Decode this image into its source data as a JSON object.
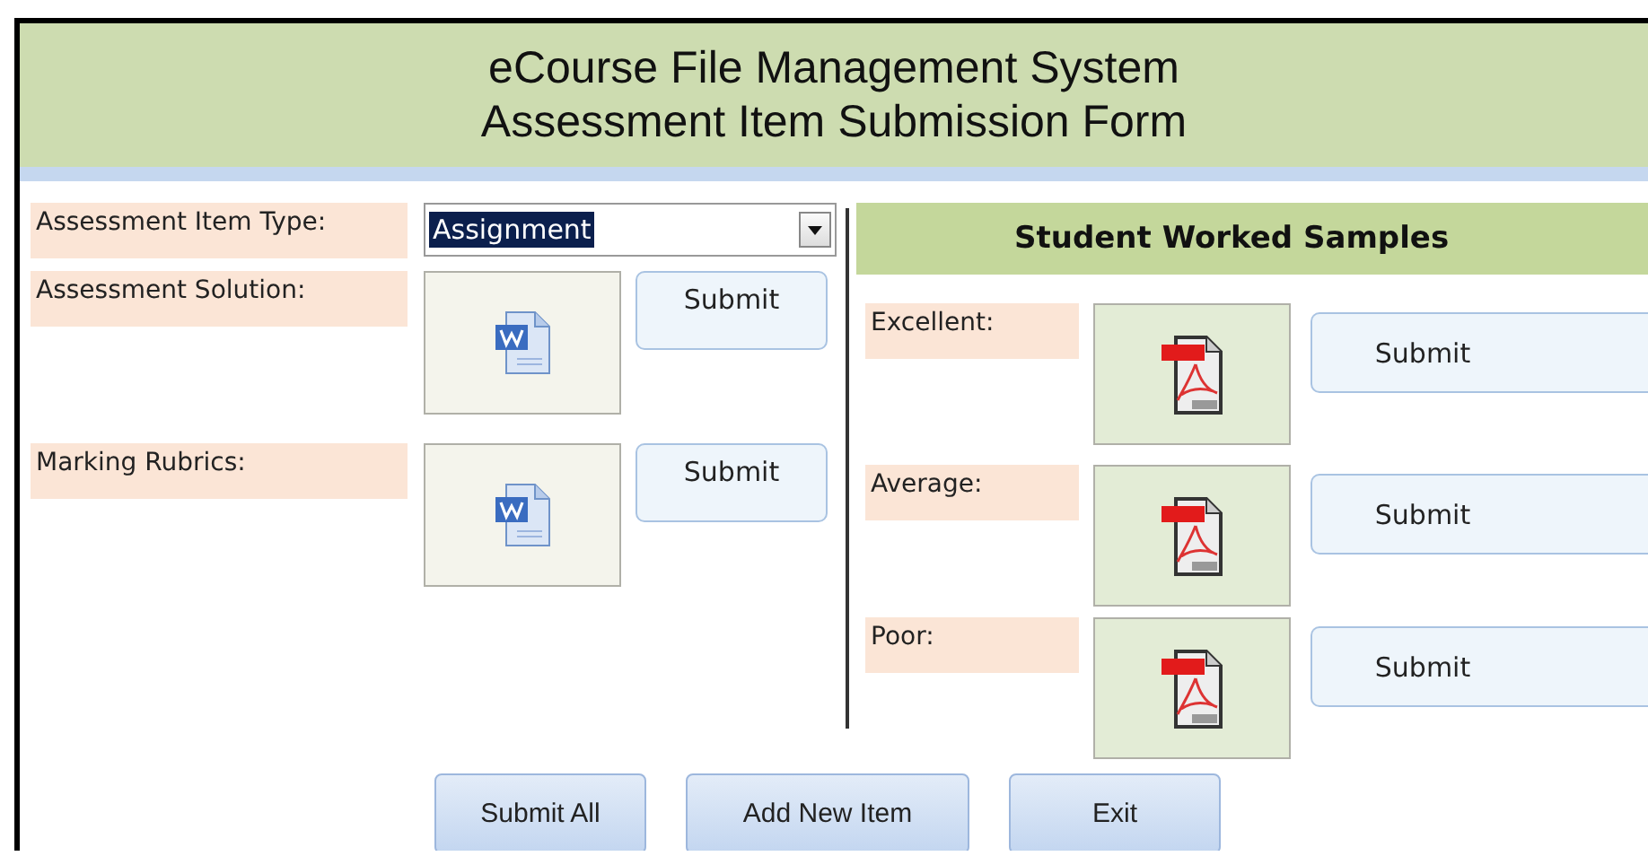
{
  "header": {
    "title": "eCourse File Management System",
    "subtitle": "Assessment Item Submission Form"
  },
  "item_type": {
    "label": "Assessment Item Type:",
    "value": "Assignment",
    "value_selected": true
  },
  "documents": [
    {
      "label": "Assessment Solution:",
      "kind": "word",
      "button": "Submit"
    },
    {
      "label": "Marking Rubrics:",
      "kind": "word",
      "button": "Submit"
    }
  ],
  "samples": {
    "title": "Student Worked Samples",
    "items": [
      {
        "label": "Excellent:",
        "kind": "pdf",
        "button": "Submit"
      },
      {
        "label": "Average:",
        "kind": "pdf",
        "button": "Submit"
      },
      {
        "label": "Poor:",
        "kind": "pdf",
        "button": "Submit"
      }
    ]
  },
  "actions": [
    "Submit All",
    "Add New Item",
    "Exit"
  ]
}
